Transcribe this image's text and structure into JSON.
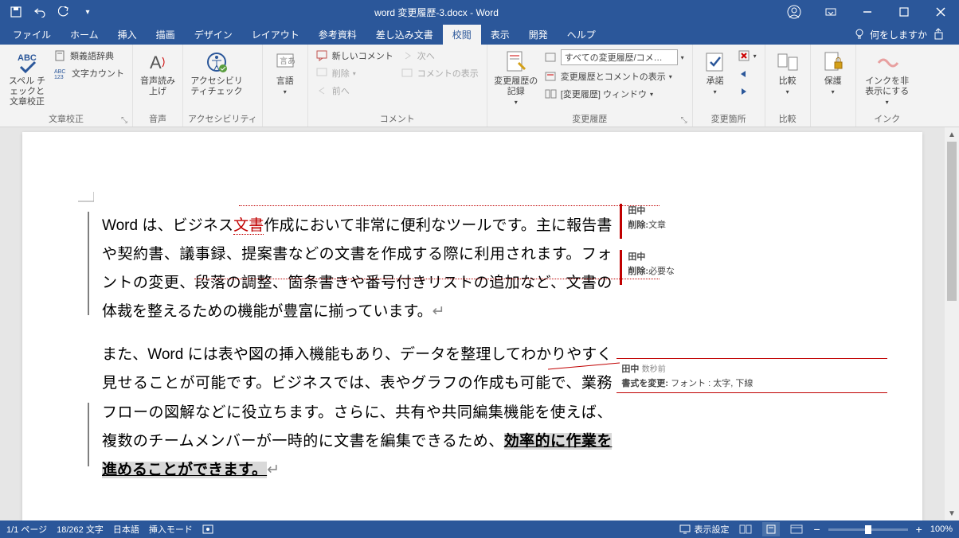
{
  "title": "word 変更履歴-3.docx - Word",
  "tabs": {
    "file": "ファイル",
    "home": "ホーム",
    "insert": "挿入",
    "draw": "描画",
    "design": "デザイン",
    "layout": "レイアウト",
    "references": "参考資料",
    "mailings": "差し込み文書",
    "review": "校閲",
    "view": "表示",
    "developer": "開発",
    "help": "ヘルプ"
  },
  "tell_me": "何をしますか",
  "ribbon": {
    "proofing": {
      "spelling": "スペル チェックと文章校正",
      "thesaurus": "類義語辞典",
      "wordcount": "文字カウント",
      "label": "文章校正"
    },
    "speech": {
      "readaloud": "音声読み上げ",
      "label": "音声"
    },
    "accessibility": {
      "check": "アクセシビリティチェック",
      "label": "アクセシビリティ"
    },
    "language": {
      "lang": "言語",
      "label": ""
    },
    "comments": {
      "new": "新しいコメント",
      "delete": "削除",
      "prev": "前へ",
      "next": "次へ",
      "show": "コメントの表示",
      "label": "コメント"
    },
    "tracking": {
      "track": "変更履歴の記録",
      "display": "すべての変更履歴/コメ…",
      "showmarkup": "変更履歴とコメントの表示",
      "pane": "[変更履歴] ウィンドウ",
      "label": "変更履歴"
    },
    "changes": {
      "accept": "承諾",
      "label": "変更箇所"
    },
    "compare": {
      "compare": "比較",
      "label": "比較"
    },
    "protect": {
      "protect": "保護",
      "label": ""
    },
    "ink": {
      "ink": "インクを非表示にする",
      "label": "インク"
    }
  },
  "document": {
    "para1_a": "Word は、ビジネス",
    "para1_track": "文書",
    "para1_b": "作成において非常に便利なツールです。主に報告書や契約書、議事録、提案書などの文書を作成する際に利用されます。フォントの変更、段落の調整、箇条書きや番号付きリストの追加など、文書の体裁を整えるための機能が豊富に揃っています。",
    "para2_a": "また、Word には表や図の挿入機能もあり、データを整理してわかりやすく見せることが可能です。ビジネスでは、表やグラフの作成も可能で、業務フローの図解などに役立ちます。さらに、共有や共同編集機能を使えば、複数のチームメンバーが一時的に文書を編集できるため、",
    "para2_hl": "効率的に作業を進めることができます。"
  },
  "revisions": {
    "r1": {
      "author": "田中",
      "label": "削除:",
      "text": "文章"
    },
    "r2": {
      "author": "田中",
      "label": "削除:",
      "text": "必要な"
    },
    "r3": {
      "author": "田中",
      "time": "数秒前",
      "label": "書式を変更:",
      "text": "フォント : 太字, 下線"
    }
  },
  "status": {
    "page": "1/1 ページ",
    "words": "18/262 文字",
    "lang": "日本語",
    "mode": "挿入モード",
    "display": "表示設定",
    "zoom": "100%"
  }
}
